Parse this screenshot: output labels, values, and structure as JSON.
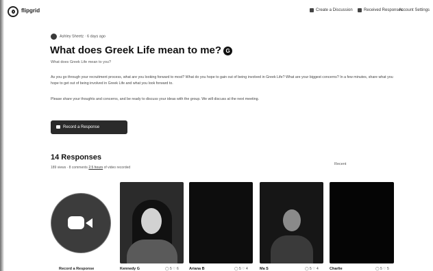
{
  "app": {
    "brand": "flipgrid"
  },
  "nav": {
    "create_label": "Create a Discussion",
    "responses_label": "Received Responses",
    "settings_label": "Account Settings"
  },
  "prompt": {
    "author": "Ashley Sheetz · 6 days ago",
    "title": "What does Greek Life mean to me?",
    "title_badge": "G",
    "subtitle": "What does Greek Life mean to you?",
    "paragraph1": "As you go through your recruitment process, what are you looking forward to most? What do you hope to gain out of being involved in Greek Life? What are your biggest concerns? In a few minutes, share what you hope to get out of being involved in Greek Life and what you look forward to.",
    "paragraph2": "Please share your thoughts and concerns, and be ready to discuss your ideas with the group. We will discuss at the next meeting.",
    "record_button": "Record a Response"
  },
  "responses": {
    "heading": "14 Responses",
    "meta_counts": "189 views · 8 comments",
    "meta_link": "2.5 hours",
    "meta_suffix": "of video recorded",
    "sort_label": "Recent"
  },
  "record_tile": {
    "label": "Record a Response"
  },
  "tiles": [
    {
      "name": "Kennedy G",
      "stats": "◯ 5  ♡ 6"
    },
    {
      "name": "Ariana B",
      "stats": "◯ 5  ♡ 4"
    },
    {
      "name": "Ma S",
      "stats": "◯ 5  ♡ 4"
    },
    {
      "name": "Charlie",
      "stats": "◯ 5  ♡ 5"
    }
  ]
}
